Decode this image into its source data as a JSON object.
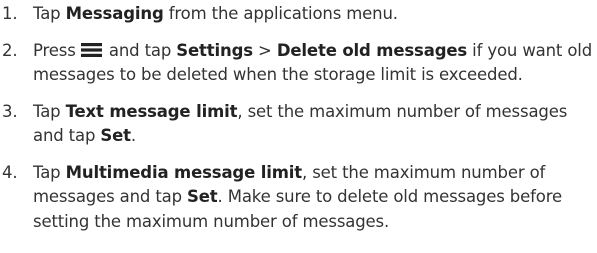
{
  "steps": [
    {
      "number": "1.",
      "parts": [
        "Tap ",
        "Messaging",
        " from the applications menu."
      ]
    },
    {
      "number": "2.",
      "icon": "menu-icon",
      "parts": [
        "Press ",
        " and tap ",
        "Settings",
        " > ",
        "Delete old messages",
        " if you want old messages to be deleted when the storage limit is exceeded."
      ]
    },
    {
      "number": "3.",
      "parts": [
        "Tap ",
        "Text message limit",
        ", set the maximum number of messages and tap ",
        "Set",
        "."
      ]
    },
    {
      "number": "4.",
      "parts": [
        "Tap ",
        "Multimedia message limit",
        ", set the maximum number of messages and tap ",
        "Set",
        ". Make sure to delete old messages before setting the maximum number of messages."
      ]
    }
  ]
}
